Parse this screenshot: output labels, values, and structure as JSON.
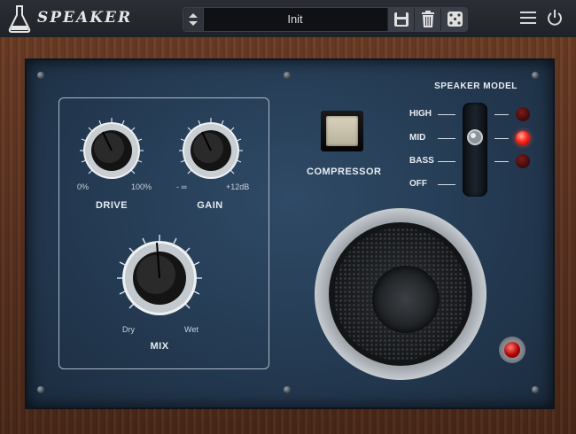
{
  "header": {
    "brand": "SPEAKER",
    "preset_name": "Init",
    "icons": {
      "logo": "flask-icon",
      "prev_next": "up-down-arrows-icon",
      "save": "save-icon",
      "delete": "trash-icon",
      "random": "dice-icon",
      "menu": "hamburger-menu-icon",
      "power": "power-icon"
    }
  },
  "controls": {
    "drive": {
      "label": "DRIVE",
      "min_label": "0%",
      "max_label": "100%",
      "value": 0.45
    },
    "gain": {
      "label": "GAIN",
      "min_label": "- ∞",
      "max_label": "+12dB",
      "value": 0.45
    },
    "mix": {
      "label": "MIX",
      "min_label": "Dry",
      "max_label": "Wet",
      "value": 0.45
    },
    "compressor": {
      "label": "COMPRESSOR",
      "on": false
    }
  },
  "speaker_model": {
    "title": "SPEAKER MODEL",
    "options": [
      "HIGH",
      "MID",
      "BASS",
      "OFF"
    ],
    "selected": "MID"
  },
  "colors": {
    "led_on": "#ff2a1a",
    "led_off": "#5a1010",
    "panel": "#243a52",
    "wood": "#5a3120"
  }
}
